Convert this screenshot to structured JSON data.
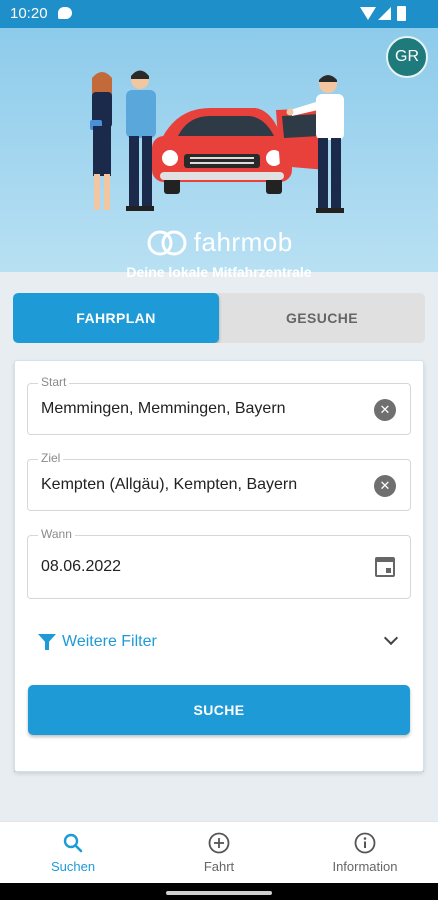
{
  "status_bar": {
    "time": "10:20"
  },
  "header": {
    "avatar_initials": "GR",
    "logo_text": "fahrmob",
    "tagline": "Deine lokale Mitfahrzentrale"
  },
  "tabs": [
    {
      "label": "FAHRPLAN",
      "active": true
    },
    {
      "label": "GESUCHE",
      "active": false
    }
  ],
  "form": {
    "start": {
      "label": "Start",
      "value": "Memmingen, Memmingen, Bayern"
    },
    "ziel": {
      "label": "Ziel",
      "value": "Kempten (Allgäu), Kempten, Bayern"
    },
    "wann": {
      "label": "Wann",
      "value": "08.06.2022"
    },
    "filter_label": "Weitere Filter",
    "search_button": "SUCHE"
  },
  "bottom_nav": [
    {
      "label": "Suchen",
      "icon": "search-icon",
      "active": true
    },
    {
      "label": "Fahrt",
      "icon": "plus-circle-icon",
      "active": false
    },
    {
      "label": "Information",
      "icon": "info-icon",
      "active": false
    }
  ],
  "colors": {
    "accent": "#1e9bd7",
    "status_bar": "#1e8fc9",
    "avatar": "#1f7a7c"
  }
}
